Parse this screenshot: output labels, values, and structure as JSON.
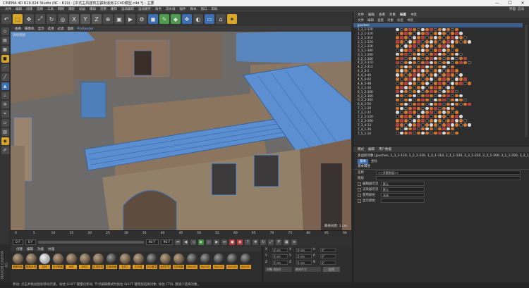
{
  "window": {
    "title": "CINEMA 4D R19.024 Studio (RC - R19) - [中式古风建筑古镇街道房子C4D模型.c4d *] - 主要",
    "min": "—",
    "max": "☐",
    "close": "✕"
  },
  "menubar": {
    "items": [
      "文件",
      "编辑",
      "创建",
      "选择",
      "工具",
      "网格",
      "捕捉",
      "动画",
      "模拟",
      "渲染",
      "雕刻",
      "运动跟踪",
      "运动图形",
      "角色",
      "流水线",
      "插件",
      "脚本",
      "窗口",
      "帮助"
    ],
    "right": "界面: 启动"
  },
  "viewport": {
    "menu": [
      "查看",
      "摄像机",
      "显示",
      "选项",
      "过滤",
      "面板"
    ],
    "menu_highlight": "ProRender",
    "label": "透视视图",
    "scale": "网格间距: 1 cm"
  },
  "timeline": {
    "ticks": [
      "0",
      "5",
      "10",
      "15",
      "20",
      "25",
      "30",
      "35",
      "40",
      "45",
      "50",
      "55",
      "60",
      "65",
      "70",
      "75",
      "80",
      "85",
      "90"
    ],
    "frame_end": "90 F"
  },
  "transport": {
    "start": "0 F",
    "current": "0 F",
    "end": "90 F",
    "end2": "90 F"
  },
  "materials": {
    "tabs": [
      "创建",
      "编辑",
      "功能",
      "纹理"
    ],
    "items": [
      {
        "label": "房屋地板",
        "style": "brown"
      },
      {
        "label": "房屋木材",
        "style": "brown"
      },
      {
        "label": "石材",
        "style": "lite"
      },
      {
        "label": "石材墙面",
        "style": "brown"
      },
      {
        "label": "木材",
        "style": "brown"
      },
      {
        "label": "木材2",
        "style": "brown"
      },
      {
        "label": "石材砖块",
        "style": "brown"
      },
      {
        "label": "石板地面",
        "style": "dark"
      },
      {
        "label": "石材3",
        "style": "brown"
      },
      {
        "label": "石头墙",
        "style": "brown"
      },
      {
        "label": "瓦片屋顶",
        "style": "dark"
      },
      {
        "label": "木材护栏",
        "style": "brown"
      },
      {
        "label": "光亮墙面",
        "style": "brown"
      },
      {
        "label": "WorldO",
        "style": "dark"
      },
      {
        "label": "WorldO",
        "style": "dark"
      },
      {
        "label": "WorldO",
        "style": "dark"
      },
      {
        "label": "WorldO",
        "style": "dark"
      },
      {
        "label": "WorldO",
        "style": "dark"
      }
    ]
  },
  "coords": {
    "rows": [
      {
        "a": "X",
        "av": "0 cm",
        "b": "X",
        "bv": "0 cm",
        "c": "H",
        "cv": "0°"
      },
      {
        "a": "Y",
        "av": "0 cm",
        "b": "Y",
        "bv": "0 cm",
        "c": "P",
        "cv": "0°"
      },
      {
        "a": "Z",
        "av": "0 cm",
        "b": "Z",
        "bv": "0 cm",
        "c": "B",
        "cv": "0°"
      }
    ],
    "mode1": "对象 (相对)",
    "mode2": "绝对尺寸",
    "apply": "应用"
  },
  "status": {
    "text": "移动: 点击并拖动鼠标移动元素。按住 SHIFT 键量化移动; 节点编辑模式时按住 SHIFT 键增加选择对象; 按住 CTRL 键减少选择对象。",
    "brand": "MAXON CINEMA 4D"
  },
  "objects": {
    "tabs": [
      "文件",
      "编辑",
      "查看",
      "对象",
      "标签",
      "书签"
    ],
    "menu": [
      "文件",
      "编辑",
      "查看",
      "对象",
      "标签",
      "书签"
    ],
    "rows": [
      {
        "name": "jpuchen",
        "root": true
      },
      {
        "name": "1_1_1-120"
      },
      {
        "name": "1_2_1-220"
      },
      {
        "name": "1_3_1-314"
      },
      {
        "name": "2_1_1-120"
      },
      {
        "name": "2_2_1-220"
      },
      {
        "name": "2_3_1-300"
      },
      {
        "name": "3_1_1-200"
      },
      {
        "name": "3_2_1-300"
      },
      {
        "name": "4_2_2-110"
      },
      {
        "name": "4_2_2-212"
      },
      {
        "name": "4_3_3-2"
      },
      {
        "name": "4_4_3-40"
      },
      {
        "name": "4_5_4-02"
      },
      {
        "name": "4_6_5-4B"
      },
      {
        "name": "5_1_1-10"
      },
      {
        "name": "6_1_2-300"
      },
      {
        "name": "6_2_2-300"
      },
      {
        "name": "6_3_2-304"
      },
      {
        "name": "6_4_2-50"
      },
      {
        "name": "7_1_1-20"
      },
      {
        "name": "7_2_1-22"
      },
      {
        "name": "7_2_2-120"
      },
      {
        "name": "7_2_3-300"
      },
      {
        "name": "7_3_4-13"
      },
      {
        "name": "7_4_1-20"
      },
      {
        "name": "7_5_1-10"
      }
    ]
  },
  "attributes": {
    "tabs": [
      "模式",
      "编辑",
      "用户数据"
    ],
    "header": "多边形对象 [jpuchen, 1_1_1-120, 1_2_1-220, 1_3_1-314, 2_1_1-120, 2_2_1-220, 2_3_1-300, 3_1_1-200, 3_2_1-300, 4_2_2-110, 4_2_2-212 ...]",
    "subtab": "基本",
    "subtab2": "坐标",
    "section": "基本属性",
    "name_key": "名称",
    "name_val": "<<多重数值>>",
    "layer_key": "图层",
    "rows": [
      {
        "k": "编辑器可见",
        "v": "默认"
      },
      {
        "k": "渲染器可见",
        "v": "默认"
      },
      {
        "k": "使用颜色",
        "v": "关闭"
      },
      {
        "k": "显示颜色",
        "v": ""
      }
    ]
  }
}
